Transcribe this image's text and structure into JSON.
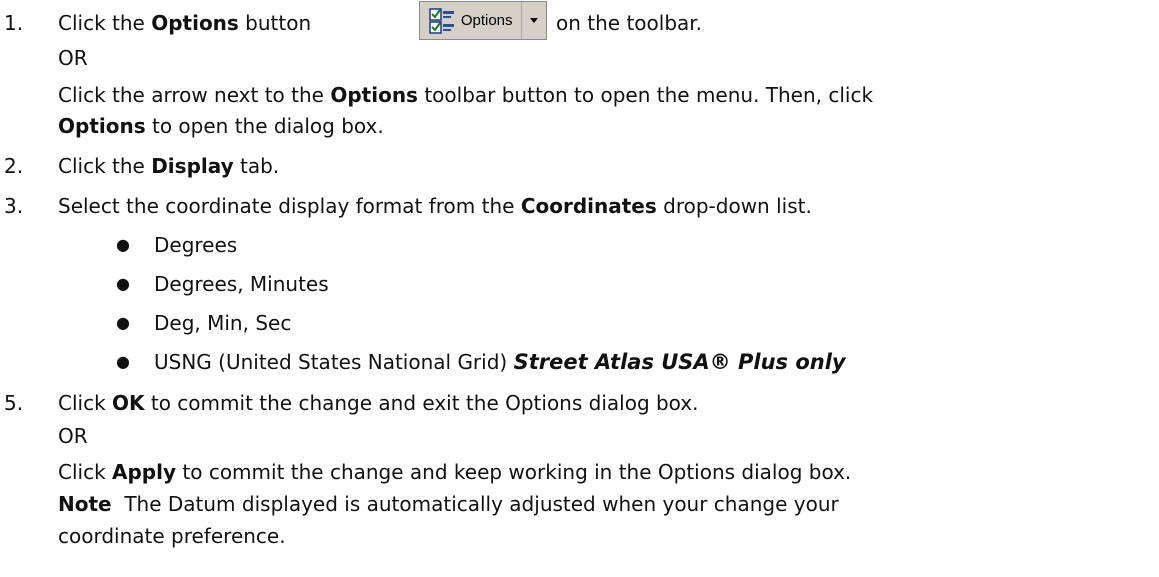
{
  "steps": {
    "s1": {
      "number": "1.",
      "pre": "Click the ",
      "bold": "Options",
      "mid": " button",
      "post": "on the toolbar.",
      "or": "OR",
      "alt_pre": "Click the arrow next to the ",
      "alt_bold": "Options",
      "alt_post": " toolbar button to open the menu. Then, click",
      "alt2_bold": "Options",
      "alt2_post": " to open the dialog box."
    },
    "s2": {
      "number": "2.",
      "pre": "Click the ",
      "bold": "Display",
      "post": " tab."
    },
    "s3": {
      "number": "3.",
      "pre": "Select the coordinate display format from the ",
      "bold": "Coordinates",
      "post": " drop-down list."
    },
    "bullets": {
      "b1": "Degrees",
      "b2": "Degrees, Minutes",
      "b3": "Deg, Min, Sec",
      "b4": "USNG (United States National Grid) ",
      "b4_emph": "Street Atlas USA® Plus only"
    },
    "s5": {
      "number": "5.",
      "pre": "Click ",
      "bold": "OK",
      "post": " to commit the change and exit the Options dialog box.",
      "or": "OR",
      "alt_pre": "Click ",
      "alt_bold": "Apply",
      "alt_post": " to commit the change and keep working in the Options dialog box.",
      "note_bold": "Note",
      "note_text": "  The Datum displayed is automatically adjusted when your change your",
      "note_text2": "coordinate preference."
    }
  },
  "toolbar_button": {
    "label": "Options",
    "icon": "checklist-icon",
    "arrow_icon": "dropdown-arrow-icon"
  }
}
